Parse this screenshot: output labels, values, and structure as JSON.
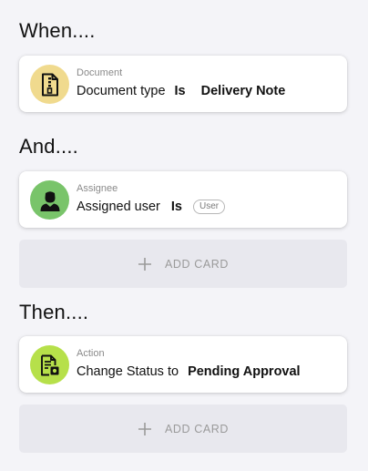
{
  "sections": {
    "when": "When....",
    "and": "And....",
    "then": "Then...."
  },
  "cards": [
    {
      "category": "Document",
      "field": "Document type",
      "operator": "Is",
      "value": "Delivery Note",
      "icon": "document-zip-icon",
      "icon_color": "#f0da8e"
    },
    {
      "category": "Assignee",
      "field": "Assigned user",
      "operator": "Is",
      "pill": "User",
      "icon": "user-icon",
      "icon_color": "#79c46a"
    },
    {
      "category": "Action",
      "field": "Change Status to",
      "value": "Pending Approval",
      "icon": "document-settings-icon",
      "icon_color": "#b6e04a"
    }
  ],
  "add_card_label": "ADD CARD"
}
